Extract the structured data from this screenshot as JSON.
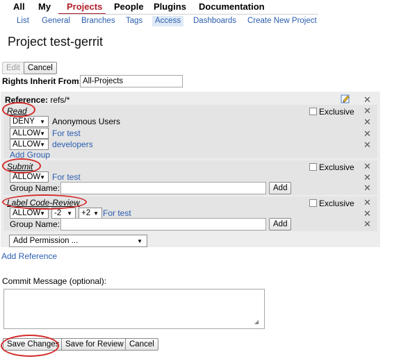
{
  "nav": {
    "items": [
      "All",
      "My",
      "Projects",
      "People",
      "Plugins",
      "Documentation"
    ],
    "active": "Projects"
  },
  "subnav": {
    "items": [
      "List",
      "General",
      "Branches",
      "Tags",
      "Access",
      "Dashboards",
      "Create New Project"
    ],
    "active": "Access"
  },
  "page": {
    "title": "Project test-gerrit"
  },
  "toolbar": {
    "edit_label": "Edit",
    "cancel_label": "Cancel"
  },
  "inherit": {
    "label": "Rights Inherit From:",
    "value": "All-Projects"
  },
  "reference": {
    "label": "Reference:",
    "pattern": "refs/*",
    "exclusive_label": "Exclusive",
    "permissions": [
      {
        "name": "Read",
        "rules": [
          {
            "action": "DENY",
            "group": "Anonymous Users",
            "group_is_link": false
          },
          {
            "action": "ALLOW",
            "group": "For test",
            "group_is_link": true
          },
          {
            "action": "ALLOW",
            "group": "developers",
            "group_is_link": true
          }
        ],
        "add_group_label": "Add Group"
      },
      {
        "name": "Submit",
        "rules": [
          {
            "action": "ALLOW",
            "group": "For test",
            "group_is_link": true
          }
        ],
        "group_name_label": "Group Name:",
        "add_label": "Add"
      },
      {
        "name": "Label Code-Review",
        "rules": [
          {
            "action": "ALLOW",
            "min": "-2",
            "max": "+2",
            "group": "For test",
            "group_is_link": true
          }
        ],
        "group_name_label": "Group Name:",
        "add_label": "Add"
      }
    ],
    "add_permission_label": "Add Permission ..."
  },
  "add_reference_label": "Add Reference",
  "commit": {
    "label": "Commit Message (optional):",
    "value": ""
  },
  "actions": {
    "save_label": "Save Changes",
    "review_label": "Save for Review",
    "cancel_label": "Cancel"
  },
  "colors": {
    "nav_active": "#b0202c",
    "link": "#2a5db0",
    "annotation": "#d42a2a"
  }
}
